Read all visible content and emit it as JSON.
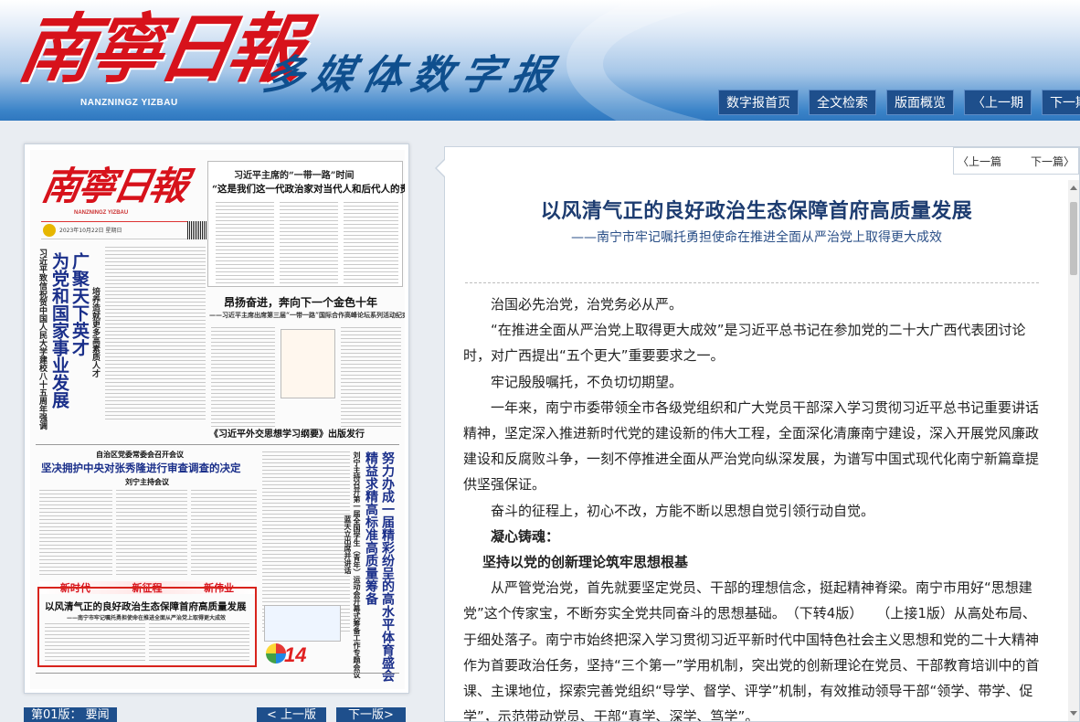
{
  "header": {
    "logo_main": "南寧日報",
    "logo_pinyin": "NANZNINGZ YIZBAU",
    "logo_sub": "多媒体数字报",
    "nav": [
      {
        "label": "数字报首页"
      },
      {
        "label": "全文检索"
      },
      {
        "label": "版面概览"
      },
      {
        "label": "上一期"
      },
      {
        "label": "下一期"
      }
    ]
  },
  "paper": {
    "masthead": "南寧日報",
    "masthead_pinyin": "NANZNINGZ YIZBAU",
    "top_kicker": "习近平主席的“一带一路”时间",
    "top_headline": "“这是我们这一代政治家对当代人和后代人的责任”",
    "vertical_lead_1": "习近平致信祝贺中国人民大学建校八十五周年强调",
    "vertical_lead_2": "为党和国家事业发展",
    "vertical_lead_3": "广聚天下英才",
    "vertical_lead_4": "培养造就更多高素质人才",
    "mid_headline": "昂扬奋进，奔向下一个金色十年",
    "mid_sub": "——习近平主席出席第三届“一带一路”国际合作高峰论坛系列活动纪实",
    "book_line": "《习近平外交思想学习纲要》出版发行",
    "left_small": "自治区党委常委会召开会议",
    "left_headline": "坚决拥护中央对张秀隆进行审查调查的决定",
    "left_byline": "刘宁主持会议",
    "right_vertical_1": "刘宁主持召开第一届全国学生（青年）运动会开幕式筹备工作专题会议",
    "right_vertical_2": "精益求精高标准高质量筹备",
    "right_vertical_3": "努力办成一届精彩纷呈的高水平体育盛会",
    "right_vertical_4": "蓝天立出席并讲话",
    "band": [
      "新时代",
      "新征程",
      "新伟业"
    ],
    "hl_title": "以风清气正的良好政治生态保障首府高质量发展",
    "hl_sub": "——南宁市牢记嘱托勇担使命在推进全面从严治党上取得更大成效",
    "countdown": "14",
    "date_line": "2023年10月22日 星期日"
  },
  "pagination": {
    "page_label": "第01版： 要闻",
    "prev": "< 上一版",
    "next": "下一版>"
  },
  "article": {
    "nav_prev": "上一篇",
    "nav_next": "下一篇",
    "title": "以风清气正的良好政治生态保障首府高质量发展",
    "subtitle": "——南宁市牢记嘱托勇担使命在推进全面从严治党上取得更大成效",
    "paragraphs": [
      "治国必先治党，治党务必从严。",
      "“在推进全面从严治党上取得更大成效”是习近平总书记在参加党的二十大广西代表团讨论时，对广西提出“五个更大”重要要求之一。",
      "牢记殷殷嘱托，不负切切期望。",
      "一年来，南宁市委带领全市各级党组织和广大党员干部深入学习贯彻习近平总书记重要讲话精神，坚定深入推进新时代党的建设新的伟大工程，全面深化清廉南宁建设，深入开展党风廉政建设和反腐败斗争，一刻不停推进全面从严治党向纵深发展，为谱写中国式现代化南宁新篇章提供坚强保证。",
      "奋斗的征程上，初心不改，方能不断以思想自觉引领行动自觉。"
    ],
    "section_1": "凝心铸魂：",
    "section_1_sub": "坚持以党的创新理论筑牢思想根基",
    "para_6": "从严管党治党，首先就要坚定党员、干部的理想信念，挺起精神脊梁。南宁市用好“思想建党”这个传家宝，不断夯实全党共同奋斗的思想基础。　（下转4版）　　（上接1版）从高处布局、于细处落子。南宁市始终把深入学习贯彻习近平新时代中国特色社会主义思想和党的二十大精神作为首要政治任务，坚持“三个第一”学用机制，突出党的创新理论在党员、干部教育培训中的首课、主课地位，探索完善党组织“导学、督学、评学”机制，有效推动领导干部“领学、带学、促学”，示范带动党员、干部“真学、深学、笃学”。"
  }
}
